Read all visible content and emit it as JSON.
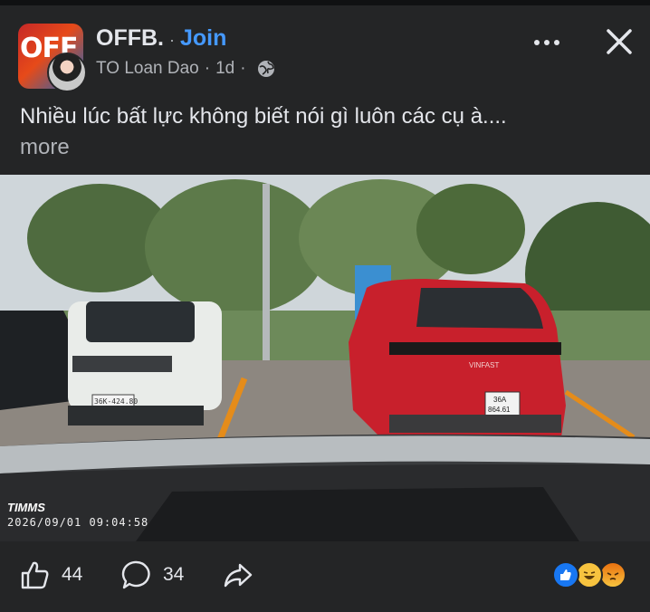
{
  "post": {
    "group_name": "OFFB.",
    "separator": "·",
    "join_label": "Join",
    "author": "TO Loan Dao",
    "time": "1d",
    "caption": "Nhiều lúc bất lực không biết nói gì luôn các cụ à....",
    "see_more": "more"
  },
  "header_icons": {
    "more": "more-options-icon",
    "close": "close-icon",
    "privacy": "globe-icon"
  },
  "group_avatar_text": "OFF",
  "media": {
    "camera_brand": "TIMMS",
    "timestamp": "2026/09/01 09:04:58",
    "car_right_brand": "VINFAST",
    "car_right_plate_line1": "36A",
    "car_right_plate_line2": "864.61",
    "car_left_plate": "36K-424.80"
  },
  "footer": {
    "like_count": "44",
    "comment_count": "34",
    "reactions": [
      "like",
      "haha",
      "angry"
    ]
  },
  "colors": {
    "background": "#242526",
    "accent": "#4599ff",
    "text": "#e4e6eb",
    "secondary_text": "#b0b3b8"
  }
}
